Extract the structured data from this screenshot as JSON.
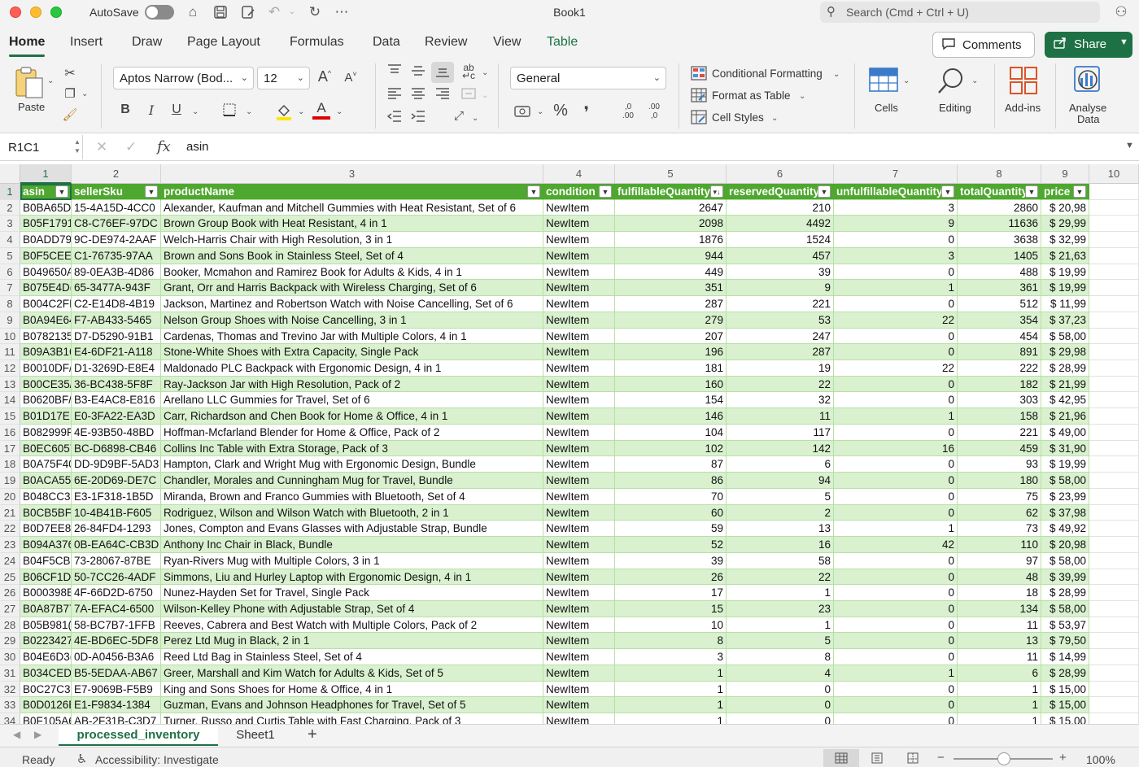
{
  "window": {
    "autosave_label": "AutoSave",
    "title": "Book1",
    "search_placeholder": "Search (Cmd + Ctrl + U)"
  },
  "menu": {
    "tabs": [
      "Home",
      "Insert",
      "Draw",
      "Page Layout",
      "Formulas",
      "Data",
      "Review",
      "View",
      "Table"
    ],
    "active": "Home",
    "comments_label": "Comments",
    "share_label": "Share"
  },
  "ribbon": {
    "paste_label": "Paste",
    "font_name": "Aptos Narrow (Bod...",
    "font_size": "12",
    "number_format": "General",
    "conditional_formatting": "Conditional Formatting",
    "format_as_table": "Format as Table",
    "cell_styles": "Cell Styles",
    "cells_label": "Cells",
    "editing_label": "Editing",
    "addins_label": "Add-ins",
    "analyse_label_1": "Analyse",
    "analyse_label_2": "Data",
    "bold_glyph": "B",
    "italic_glyph": "I",
    "underline_glyph": "U",
    "grow_font_glyph": "A",
    "shrink_font_glyph": "A",
    "font_color_glyph": "A",
    "percent_glyph": "%",
    "comma_glyph": "❜",
    "inc_decimal_glyph": ",0 .00",
    "dec_decimal_glyph": ".00 ,0"
  },
  "formula_bar": {
    "name_box": "R1C1",
    "fx": "fx",
    "content": "asin"
  },
  "grid": {
    "column_numbers": [
      "1",
      "2",
      "3",
      "4",
      "5",
      "6",
      "7",
      "8",
      "9",
      "10"
    ],
    "headers": [
      "asin",
      "sellerSku",
      "productName",
      "condition",
      "fulfillableQuantity",
      "reservedQuantity",
      "unfulfillableQuantity",
      "totalQuantity",
      "price"
    ],
    "rows": [
      [
        "B0BA65D:",
        "15-4A15D-4CC0",
        "Alexander, Kaufman and Mitchell Gummies with Heat Resistant, Set of 6",
        "NewItem",
        "2647",
        "210",
        "3",
        "2860",
        "$ 20,98"
      ],
      [
        "B05F1791",
        "C8-C76EF-97DC",
        "Brown Group Book with Heat Resistant, 4 in 1",
        "NewItem",
        "2098",
        "4492",
        "9",
        "11636",
        "$ 29,99"
      ],
      [
        "B0ADD79",
        "9C-DE974-2AAF",
        "Welch-Harris Chair with High Resolution, 3 in 1",
        "NewItem",
        "1876",
        "1524",
        "0",
        "3638",
        "$ 32,99"
      ],
      [
        "B0F5CEEI",
        "C1-76735-97AA",
        "Brown and Sons Book in Stainless Steel, Set of 4",
        "NewItem",
        "944",
        "457",
        "3",
        "1405",
        "$ 21,63"
      ],
      [
        "B049650A",
        "89-0EA3B-4D86",
        "Booker, Mcmahon and Ramirez Book for Adults & Kids, 4 in 1",
        "NewItem",
        "449",
        "39",
        "0",
        "488",
        "$ 19,99"
      ],
      [
        "B075E4D(",
        "65-3477A-943F",
        "Grant, Orr and Harris Backpack with Wireless Charging, Set of 6",
        "NewItem",
        "351",
        "9",
        "1",
        "361",
        "$ 19,99"
      ],
      [
        "B004C2FI",
        "C2-E14D8-4B19",
        "Jackson, Martinez and Robertson Watch with Noise Cancelling, Set of 6",
        "NewItem",
        "287",
        "221",
        "0",
        "512",
        "$ 11,99"
      ],
      [
        "B0A94E64",
        "F7-AB433-5465",
        "Nelson Group Shoes with Noise Cancelling, 3 in 1",
        "NewItem",
        "279",
        "53",
        "22",
        "354",
        "$ 37,23"
      ],
      [
        "B0782135",
        "D7-D5290-91B1",
        "Cardenas, Thomas and Trevino Jar with Multiple Colors, 4 in 1",
        "NewItem",
        "207",
        "247",
        "0",
        "454",
        "$ 58,00"
      ],
      [
        "B09A3B16",
        "E4-6DF21-A118",
        "Stone-White Shoes with Extra Capacity, Single Pack",
        "NewItem",
        "196",
        "287",
        "0",
        "891",
        "$ 29,98"
      ],
      [
        "B0010DF/",
        "D1-3269D-E8E4",
        "Maldonado PLC Backpack with Ergonomic Design, 4 in 1",
        "NewItem",
        "181",
        "19",
        "22",
        "222",
        "$ 28,99"
      ],
      [
        "B00CE35/",
        "36-BC438-5F8F",
        "Ray-Jackson Jar with High Resolution, Pack of 2",
        "NewItem",
        "160",
        "22",
        "0",
        "182",
        "$ 21,99"
      ],
      [
        "B0620BF/",
        "B3-E4AC8-E816",
        "Arellano LLC Gummies for Travel, Set of 6",
        "NewItem",
        "154",
        "32",
        "0",
        "303",
        "$ 42,95"
      ],
      [
        "B01D17E:",
        "E0-3FA22-EA3D",
        "Carr, Richardson and Chen Book for Home & Office, 4 in 1",
        "NewItem",
        "146",
        "11",
        "1",
        "158",
        "$ 21,96"
      ],
      [
        "B082999F",
        "4E-93B50-48BD",
        "Hoffman-Mcfarland Blender for Home & Office, Pack of 2",
        "NewItem",
        "104",
        "117",
        "0",
        "221",
        "$ 49,00"
      ],
      [
        "B0EC6057",
        "BC-D6898-CB46",
        "Collins Inc Table with Extra Storage, Pack of 3",
        "NewItem",
        "102",
        "142",
        "16",
        "459",
        "$ 31,90"
      ],
      [
        "B0A75F40",
        "DD-9D9BF-5AD3",
        "Hampton, Clark and Wright Mug with Ergonomic Design, Bundle",
        "NewItem",
        "87",
        "6",
        "0",
        "93",
        "$ 19,99"
      ],
      [
        "B0ACA55/",
        "6E-20D69-DE7C",
        "Chandler, Morales and Cunningham Mug for Travel, Bundle",
        "NewItem",
        "86",
        "94",
        "0",
        "180",
        "$ 58,00"
      ],
      [
        "B048CC3",
        "E3-1F318-1B5D",
        "Miranda, Brown and Franco Gummies with Bluetooth, Set of 4",
        "NewItem",
        "70",
        "5",
        "0",
        "75",
        "$ 23,99"
      ],
      [
        "B0CB5BF:",
        "10-4B41B-F605",
        "Rodriguez, Wilson and Wilson Watch with Bluetooth, 2 in 1",
        "NewItem",
        "60",
        "2",
        "0",
        "62",
        "$ 37,98"
      ],
      [
        "B0D7EE8I",
        "26-84FD4-1293",
        "Jones, Compton and Evans Glasses with Adjustable Strap, Bundle",
        "NewItem",
        "59",
        "13",
        "1",
        "73",
        "$ 49,92"
      ],
      [
        "B094A376",
        "0B-EA64C-CB3D",
        "Anthony Inc Chair in Black, Bundle",
        "NewItem",
        "52",
        "16",
        "42",
        "110",
        "$ 20,98"
      ],
      [
        "B04F5CB:",
        "73-28067-87BE",
        "Ryan-Rivers Mug with Multiple Colors, 3 in 1",
        "NewItem",
        "39",
        "58",
        "0",
        "97",
        "$ 58,00"
      ],
      [
        "B06CF1D(",
        "50-7CC26-4ADF",
        "Simmons, Liu and Hurley Laptop with Ergonomic Design, 4 in 1",
        "NewItem",
        "26",
        "22",
        "0",
        "48",
        "$ 39,99"
      ],
      [
        "B000398E",
        "4F-66D2D-6750",
        "Nunez-Hayden Set for Travel, Single Pack",
        "NewItem",
        "17",
        "1",
        "0",
        "18",
        "$ 28,99"
      ],
      [
        "B0A87B77",
        "7A-EFAC4-6500",
        "Wilson-Kelley Phone with Adjustable Strap, Set of 4",
        "NewItem",
        "15",
        "23",
        "0",
        "134",
        "$ 58,00"
      ],
      [
        "B05B981(",
        "58-BC7B7-1FFB",
        "Reeves, Cabrera and Best Watch with Multiple Colors, Pack of 2",
        "NewItem",
        "10",
        "1",
        "0",
        "11",
        "$ 53,97"
      ],
      [
        "B0223427",
        "4E-BD6EC-5DF8",
        "Perez Ltd Mug in Black, 2 in 1",
        "NewItem",
        "8",
        "5",
        "0",
        "13",
        "$ 79,50"
      ],
      [
        "B04E6D3(",
        "0D-A0456-B3A6",
        "Reed Ltd Bag in Stainless Steel, Set of 4",
        "NewItem",
        "3",
        "8",
        "0",
        "11",
        "$ 14,99"
      ],
      [
        "B034CED",
        "B5-5EDAA-AB67",
        "Greer, Marshall and Kim Watch for Adults & Kids, Set of 5",
        "NewItem",
        "1",
        "4",
        "1",
        "6",
        "$ 28,99"
      ],
      [
        "B0C27C3",
        "E7-9069B-F5B9",
        "King and Sons Shoes for Home & Office, 4 in 1",
        "NewItem",
        "1",
        "0",
        "0",
        "1",
        "$ 15,00"
      ],
      [
        "B0D0126E",
        "E1-F9834-1384",
        "Guzman, Evans and Johnson Headphones for Travel, Set of 5",
        "NewItem",
        "1",
        "0",
        "0",
        "1",
        "$ 15,00"
      ],
      [
        "B0F105A6",
        "AB-2F31B-C3D7",
        "Turner, Russo and Curtis Table with Fast Charging, Pack of 3",
        "NewItem",
        "1",
        "0",
        "0",
        "1",
        "$ 15,00"
      ]
    ]
  },
  "sheets": {
    "tabs": [
      "processed_inventory",
      "Sheet1"
    ],
    "active": "processed_inventory"
  },
  "status": {
    "ready": "Ready",
    "accessibility": "Accessibility: Investigate",
    "zoom": "100%"
  },
  "colors": {
    "accent": "#1e7145",
    "table_header": "#4ea72e",
    "band": "#d9f1cf"
  }
}
